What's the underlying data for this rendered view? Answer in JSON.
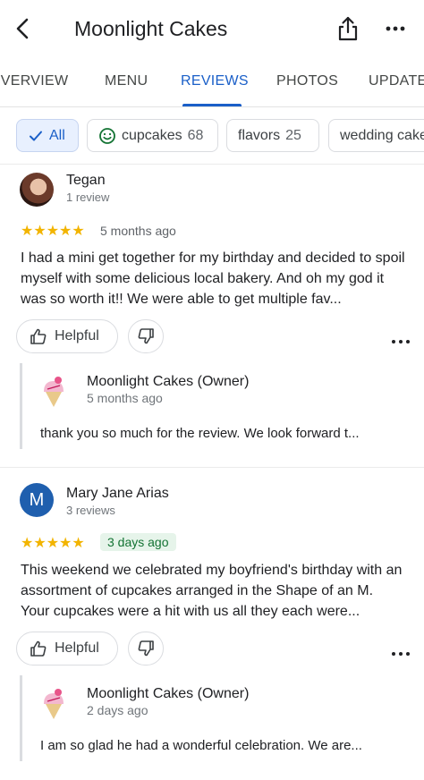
{
  "header": {
    "title": "Moonlight Cakes",
    "icons": {
      "back": "chevron-left-icon",
      "share": "share-icon",
      "more": "more-horizontal-icon"
    }
  },
  "tabs": [
    {
      "label": "OVERVIEW",
      "active": false
    },
    {
      "label": "MENU",
      "active": false
    },
    {
      "label": "REVIEWS",
      "active": true
    },
    {
      "label": "PHOTOS",
      "active": false
    },
    {
      "label": "UPDATES",
      "active": false
    }
  ],
  "chips": [
    {
      "label": "All",
      "count": "",
      "selected": true,
      "icon": "check-icon"
    },
    {
      "label": "cupcakes",
      "count": "68",
      "selected": false,
      "icon": "smiley-icon"
    },
    {
      "label": "flavors",
      "count": "25",
      "selected": false,
      "icon": ""
    },
    {
      "label": "wedding cake",
      "count": "",
      "selected": false,
      "icon": ""
    }
  ],
  "reviews": [
    {
      "name": "Tegan",
      "subtitle": "1 review",
      "avatar": "photo",
      "rating": 5,
      "stars": "★★★★★",
      "date": "5 months ago",
      "text": "I had a mini get together for my birthday and decided to spoil myself with some delicious local bakery. And oh my god it was so worth it!! We were able to get multiple fav...",
      "helpful_label": "Helpful",
      "reply": {
        "name": "Moonlight Cakes (Owner)",
        "date": "5 months ago",
        "text": "thank you so much for the review. We look forward t..."
      }
    },
    {
      "name": "Mary Jane Arias",
      "subtitle": "3 reviews",
      "avatar_letter": "M",
      "rating": 5,
      "stars": "★★★★★",
      "date": "3 days ago",
      "text": "This weekend we celebrated my boyfriend's birthday with an assortment of cupcakes arranged in the Shape of an M.  Your cupcakes were a hit with us all they each were...",
      "helpful_label": "Helpful",
      "reply": {
        "name": "Moonlight Cakes (Owner)",
        "date": "2 days ago",
        "text": "I am so glad he had a wonderful celebration. We are..."
      }
    }
  ],
  "colors": {
    "accent": "#1a5fc8",
    "star": "#f2b400",
    "avatar_letter_bg": "#1f5fae",
    "fresh_badge_bg": "#e6f4ea",
    "fresh_badge_text": "#137333"
  }
}
